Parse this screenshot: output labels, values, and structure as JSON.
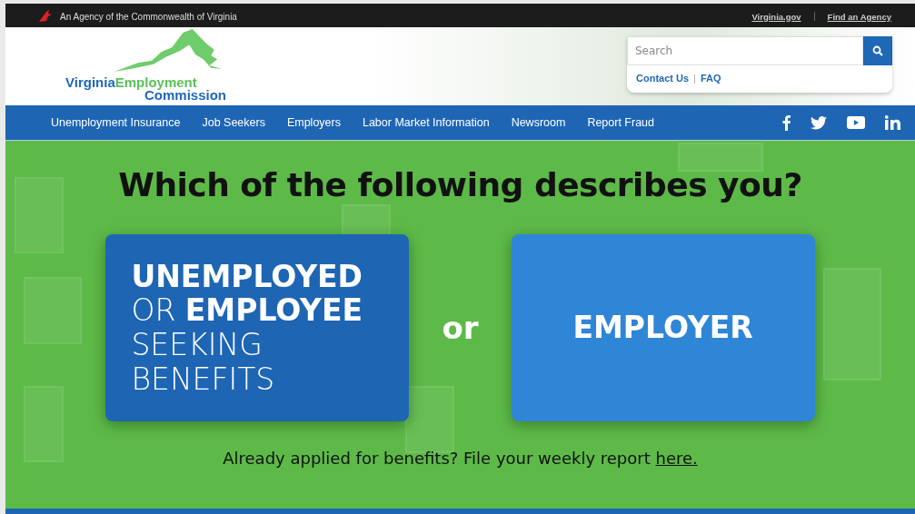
{
  "top_bar": {
    "agency_text": "An Agency of the Commonwealth of Virginia",
    "links": [
      "Virginia.gov",
      "Find an Agency"
    ]
  },
  "header": {
    "logo": {
      "line_1_part_1": "Virginia",
      "line_1_part_2": "Employment",
      "line_2": "Commission"
    },
    "search": {
      "placeholder": "Search"
    },
    "links": [
      "Contact Us",
      "FAQ"
    ],
    "link_separator": "|"
  },
  "nav": {
    "items": [
      "Unemployment Insurance",
      "Job Seekers",
      "Employers",
      "Labor Market Information",
      "Newsroom",
      "Report Fraud"
    ]
  },
  "hero": {
    "title": "Which of the following describes you?",
    "choices": [
      {
        "lines": [
          "**UNEMPLOYED**",
          "OR **EMPLOYEE**",
          "SEEKING",
          "BENEFITS"
        ],
        "color": "#1e65b4"
      },
      {
        "lines": [
          "**EMPLOYER**"
        ],
        "color": "#2f86d6"
      }
    ],
    "separator": "or",
    "footer_text": "Already applied for benefits? File your weekly report",
    "footer_link": "here."
  }
}
